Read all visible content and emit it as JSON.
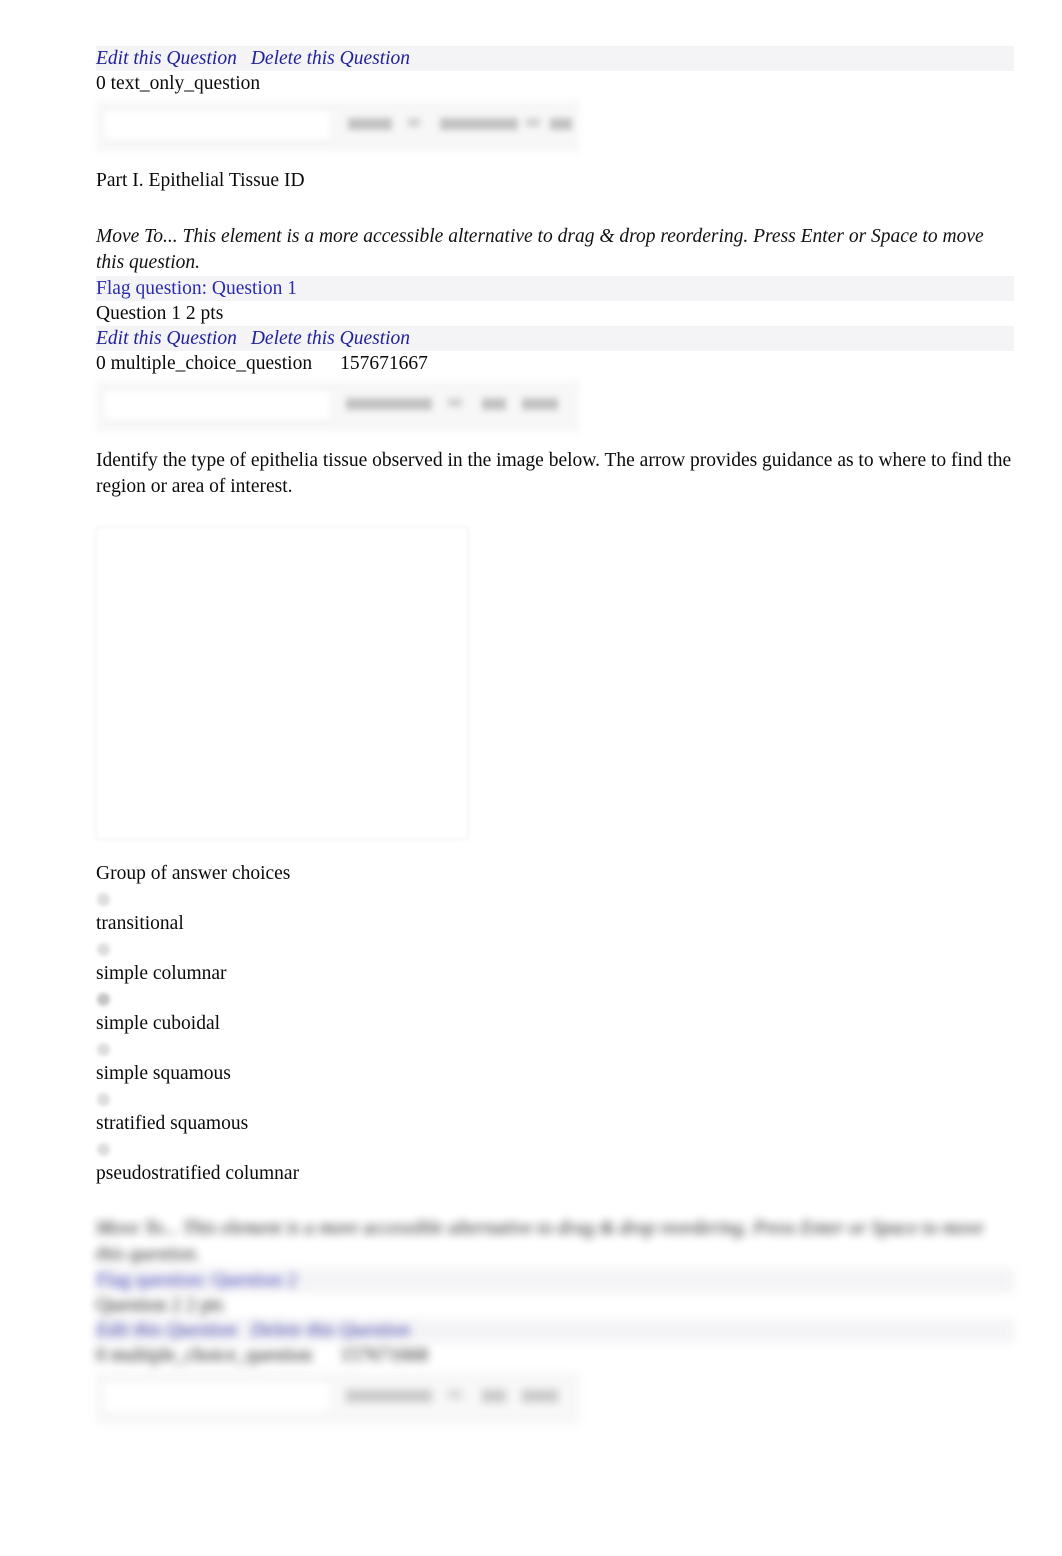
{
  "document": {
    "background_color": "#ffffff",
    "link_color": "#21219c",
    "text_color": "#0a0a0a"
  },
  "text_only_question": {
    "edit_link": "Edit this Question",
    "delete_link": "Delete this Question",
    "meta_line": "0 text_only_question",
    "heading": "Part I. Epithelial Tissue ID",
    "toolbar": {
      "name": "rich-content-editor-toolbar"
    }
  },
  "question_1": {
    "move_to_text": "Move To... This element is a more accessible alternative to drag & drop reordering. Press Enter or Space to move this question.",
    "flag_link": "Flag question: Question 1",
    "question_header": "Question 1 2 pts",
    "edit_link": "Edit this Question",
    "delete_link": "Delete this Question",
    "meta_type": "0 multiple_choice_question",
    "meta_id": "157671667",
    "prompt": "Identify the type of epithelia tissue observed in the image below. The arrow provides guidance as to where to find the region or area of interest.",
    "image_placeholder_name": "tissue-histology-image",
    "answers_label": "Group of answer choices",
    "choices": [
      "transitional",
      "simple columnar",
      "simple cuboidal",
      "simple squamous",
      "stratified squamous",
      "pseudostratified columnar"
    ]
  },
  "question_2": {
    "move_to_text": "Move To... This element is a more accessible alternative to drag & drop reordering. Press Enter or Space to move this question.",
    "flag_link": "Flag question: Question 2",
    "question_header": "Question 2 2 pts",
    "edit_link": "Edit this Question",
    "delete_link": "Delete this Question",
    "meta_type": "0 multiple_choice_question",
    "meta_id": "157671668"
  }
}
